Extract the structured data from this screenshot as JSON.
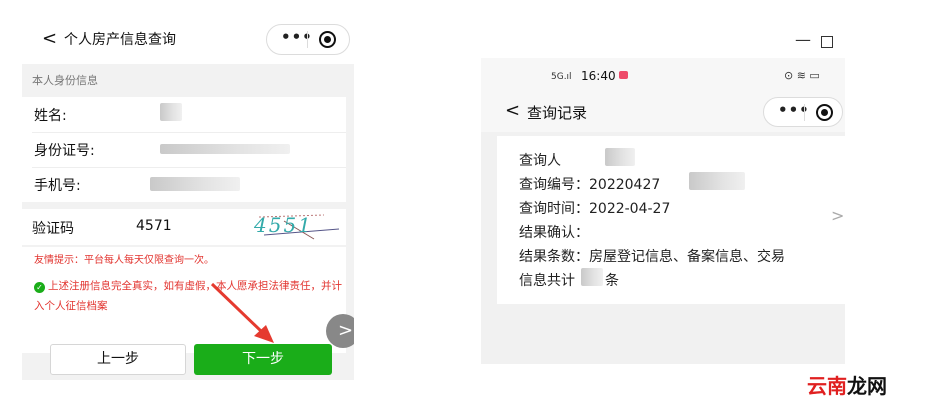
{
  "left_screen": {
    "nav": {
      "back": "<",
      "title": "个人房产信息查询",
      "more": "•••"
    },
    "section_title": "本人身份信息",
    "fields": [
      {
        "label": "姓名:"
      },
      {
        "label": "身份证号:"
      },
      {
        "label": "手机号:"
      }
    ],
    "captcha": {
      "label": "验证码",
      "value": "4571",
      "image_text": "4551"
    },
    "tip": "友情提示：平台每人每天仅限查询一次。",
    "agreement": "上述注册信息完全真实，如有虚假，本人愿承担法律责任，并计入个人征信档案",
    "check_mark": "✓",
    "buttons": {
      "prev": "上一步",
      "next": "下一步"
    },
    "side_arrow": ">"
  },
  "right_screen": {
    "window": {
      "minimize": "—"
    },
    "status": {
      "signal": "5G.ıl",
      "time": "16:40",
      "icons": "⊙ ≋ ▭"
    },
    "nav": {
      "back": "<",
      "title": "查询记录",
      "more": "•••"
    },
    "record": {
      "person": "查询人",
      "number": "查询编号：20220427",
      "time": "查询时间：2022-04-27",
      "result": "结果确认：",
      "count_line1": "结果条数：房屋登记信息、备案信息、交易",
      "count_line2_a": "信息共计",
      "count_line2_b": "条",
      "chevron": ">"
    }
  },
  "watermark": {
    "part1": "云南",
    "part2": "龙网"
  },
  "colors": {
    "green": "#1aad19",
    "red": "#e2342f",
    "arrow": "#e53a2f"
  }
}
